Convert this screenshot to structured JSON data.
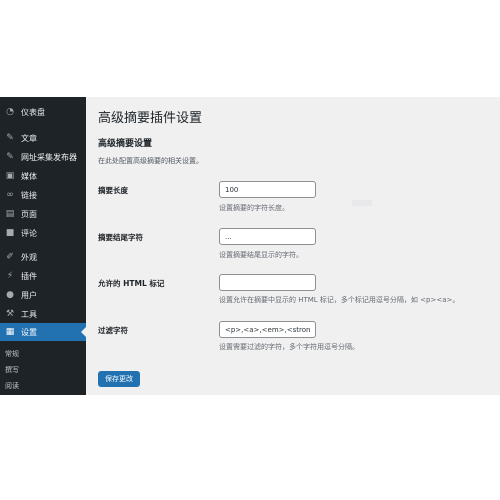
{
  "sidebar": {
    "items": [
      {
        "label": "仪表盘",
        "icon": "dashboard-icon"
      },
      {
        "label": "文章",
        "icon": "pin-icon"
      },
      {
        "label": "网址采集发布器",
        "icon": "pin-icon"
      },
      {
        "label": "媒体",
        "icon": "media-icon"
      },
      {
        "label": "链接",
        "icon": "link-icon"
      },
      {
        "label": "页面",
        "icon": "page-icon"
      },
      {
        "label": "评论",
        "icon": "comment-icon"
      },
      {
        "label": "外观",
        "icon": "brush-icon"
      },
      {
        "label": "插件",
        "icon": "plugin-icon"
      },
      {
        "label": "用户",
        "icon": "user-icon"
      },
      {
        "label": "工具",
        "icon": "wrench-icon"
      },
      {
        "label": "设置",
        "icon": "settings-icon",
        "active": true
      }
    ],
    "submenu": [
      "常规",
      "撰写",
      "阅读"
    ],
    "active_color": "#2271b1"
  },
  "page": {
    "title": "高级摘要插件设置",
    "section_title": "高级摘要设置",
    "section_desc": "在此处配置高级摘要的相关设置。",
    "fields": [
      {
        "label": "摘要长度",
        "value": "100",
        "placeholder": "",
        "help": "设置摘要的字符长度。"
      },
      {
        "label": "摘要结尾字符",
        "value": "...",
        "placeholder": "",
        "help": "设置摘要结尾显示的字符。"
      },
      {
        "label": "允许的 HTML 标记",
        "value": "",
        "placeholder": "",
        "help": "设置允许在摘要中显示的 HTML 标记，多个标记用逗号分隔，如 <p><a>。"
      },
      {
        "label": "过滤字符",
        "value": "<p>,<a>,<em>,<strong>",
        "placeholder": "",
        "help": "设置需要过滤的字符，多个字符用逗号分隔。"
      }
    ],
    "save_label": "保存更改"
  }
}
